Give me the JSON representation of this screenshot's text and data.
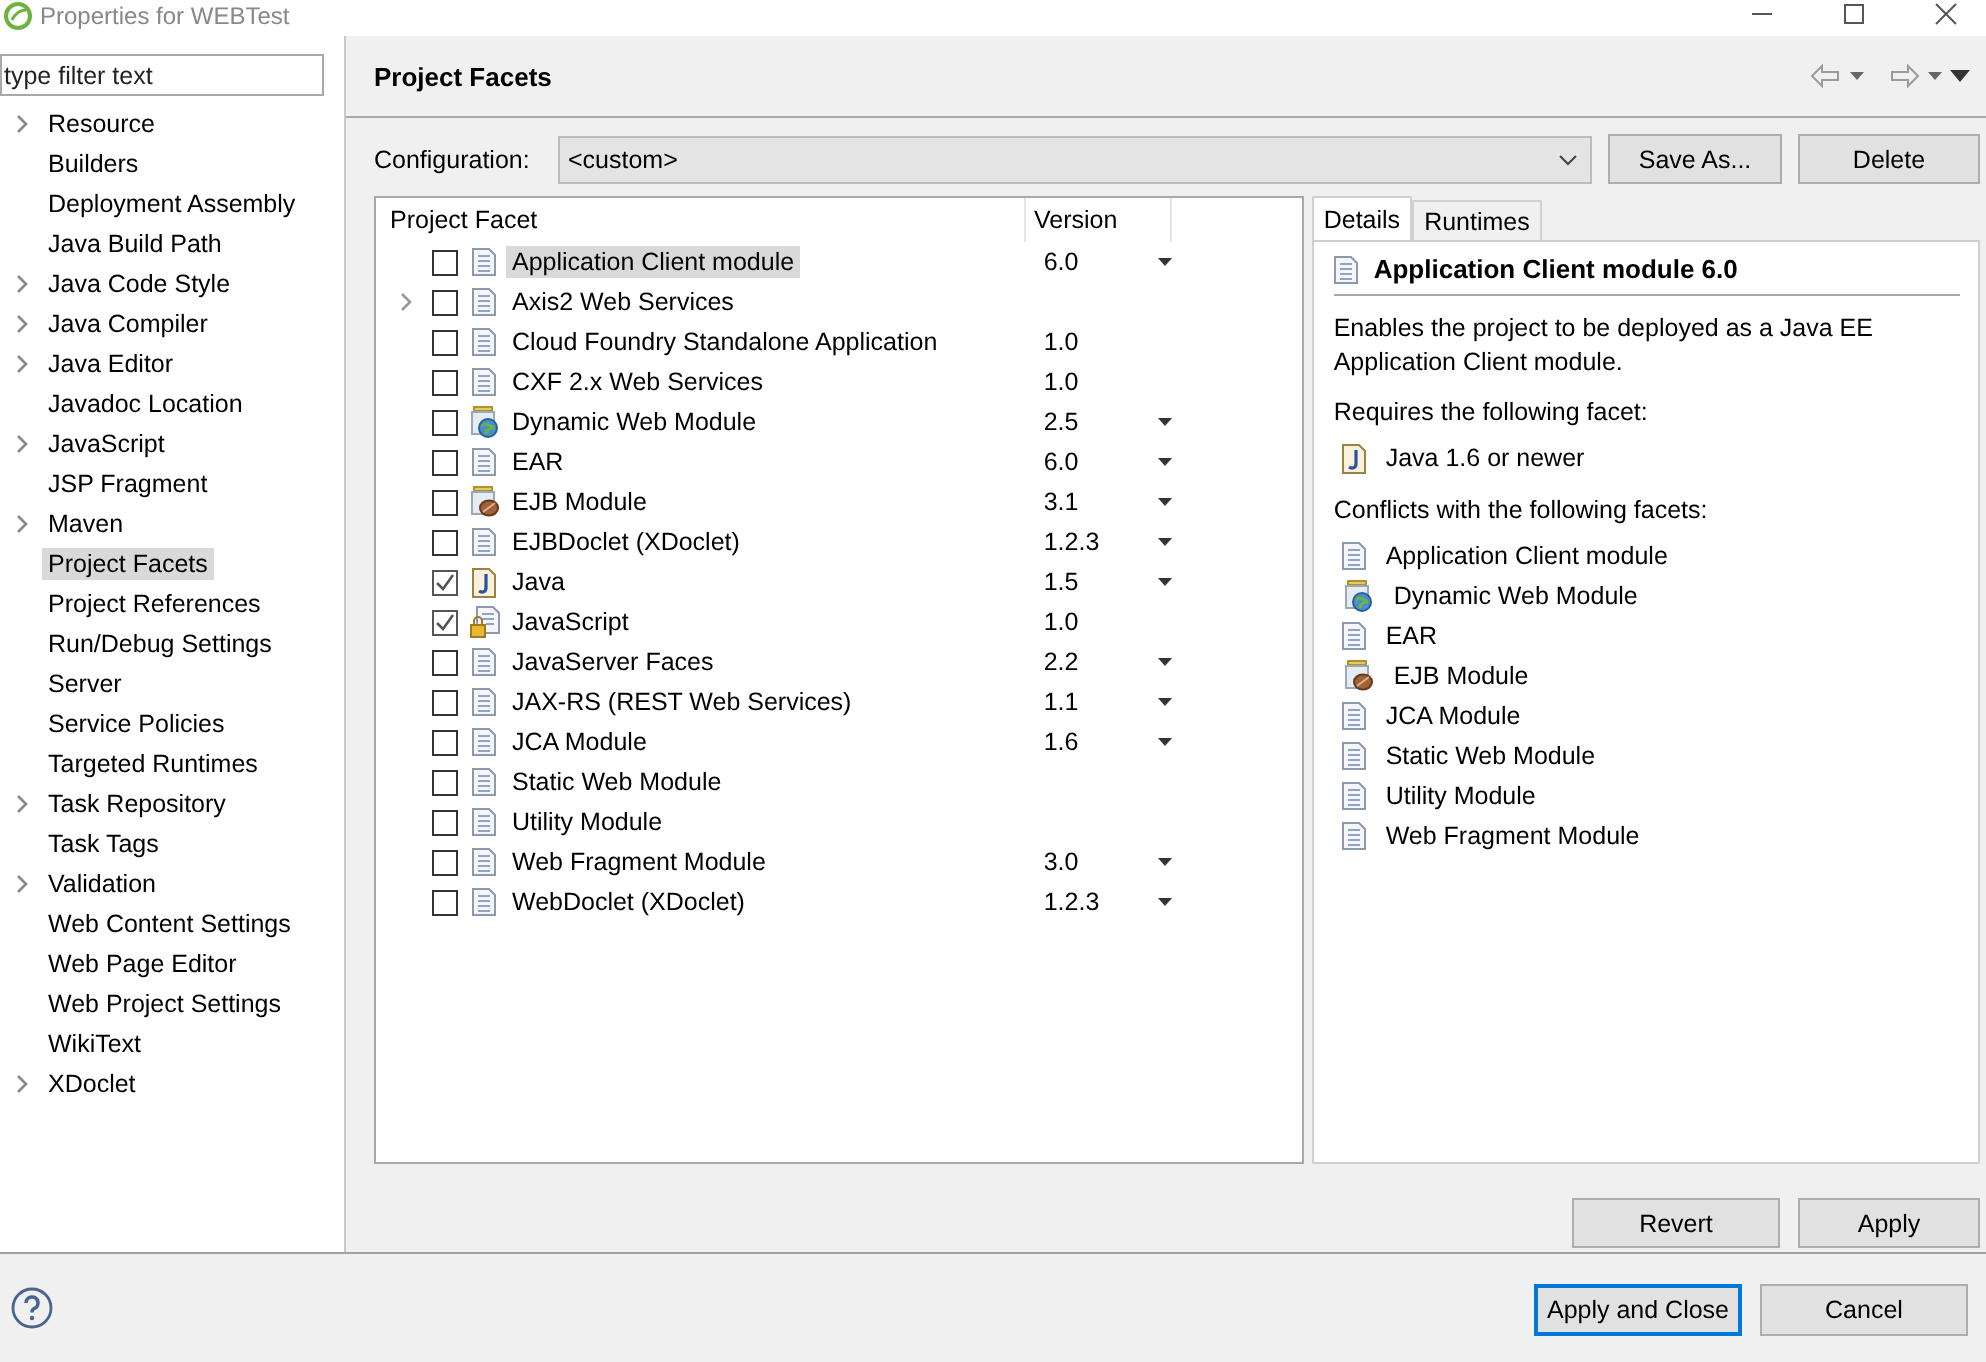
{
  "window": {
    "title": "Properties for WEBTest"
  },
  "sidebar": {
    "filter": {
      "placeholder": "type filter text"
    },
    "items": [
      {
        "label": "Resource",
        "expandable": true,
        "selected": false
      },
      {
        "label": "Builders",
        "expandable": false,
        "selected": false
      },
      {
        "label": "Deployment Assembly",
        "expandable": false,
        "selected": false
      },
      {
        "label": "Java Build Path",
        "expandable": false,
        "selected": false
      },
      {
        "label": "Java Code Style",
        "expandable": true,
        "selected": false
      },
      {
        "label": "Java Compiler",
        "expandable": true,
        "selected": false
      },
      {
        "label": "Java Editor",
        "expandable": true,
        "selected": false
      },
      {
        "label": "Javadoc Location",
        "expandable": false,
        "selected": false
      },
      {
        "label": "JavaScript",
        "expandable": true,
        "selected": false
      },
      {
        "label": "JSP Fragment",
        "expandable": false,
        "selected": false
      },
      {
        "label": "Maven",
        "expandable": true,
        "selected": false
      },
      {
        "label": "Project Facets",
        "expandable": false,
        "selected": true
      },
      {
        "label": "Project References",
        "expandable": false,
        "selected": false
      },
      {
        "label": "Run/Debug Settings",
        "expandable": false,
        "selected": false
      },
      {
        "label": "Server",
        "expandable": false,
        "selected": false
      },
      {
        "label": "Service Policies",
        "expandable": false,
        "selected": false
      },
      {
        "label": "Targeted Runtimes",
        "expandable": false,
        "selected": false
      },
      {
        "label": "Task Repository",
        "expandable": true,
        "selected": false
      },
      {
        "label": "Task Tags",
        "expandable": false,
        "selected": false
      },
      {
        "label": "Validation",
        "expandable": true,
        "selected": false
      },
      {
        "label": "Web Content Settings",
        "expandable": false,
        "selected": false
      },
      {
        "label": "Web Page Editor",
        "expandable": false,
        "selected": false
      },
      {
        "label": "Web Project Settings",
        "expandable": false,
        "selected": false
      },
      {
        "label": "WikiText",
        "expandable": false,
        "selected": false
      },
      {
        "label": "XDoclet",
        "expandable": true,
        "selected": false
      }
    ]
  },
  "page": {
    "title": "Project Facets",
    "configuration": {
      "label": "Configuration:",
      "value": "<custom>"
    },
    "buttons": [
      "Save As...",
      "Delete"
    ]
  },
  "facets": {
    "columns": [
      "Project Facet",
      "Version"
    ],
    "rows": [
      {
        "name": "Application Client module",
        "checked": false,
        "kind": "doc",
        "expandable": false,
        "version": "6.0",
        "has_menu": true,
        "selected": true
      },
      {
        "name": "Axis2 Web Services",
        "checked": false,
        "kind": "doc",
        "expandable": true,
        "has_menu": false,
        "selected": false
      },
      {
        "name": "Cloud Foundry Standalone Application",
        "checked": false,
        "kind": "doc",
        "expandable": false,
        "version": "1.0",
        "has_menu": false,
        "selected": false
      },
      {
        "name": "CXF 2.x Web Services",
        "checked": false,
        "kind": "doc",
        "expandable": false,
        "version": "1.0",
        "has_menu": false,
        "selected": false
      },
      {
        "name": "Dynamic Web Module",
        "checked": false,
        "kind": "web",
        "expandable": false,
        "version": "2.5",
        "has_menu": true,
        "selected": false
      },
      {
        "name": "EAR",
        "checked": false,
        "kind": "doc",
        "expandable": false,
        "version": "6.0",
        "has_menu": true,
        "selected": false
      },
      {
        "name": "EJB Module",
        "checked": false,
        "kind": "ejb",
        "expandable": false,
        "version": "3.1",
        "has_menu": true,
        "selected": false
      },
      {
        "name": "EJBDoclet (XDoclet)",
        "checked": false,
        "kind": "doc",
        "expandable": false,
        "version": "1.2.3",
        "has_menu": true,
        "selected": false
      },
      {
        "name": "Java",
        "checked": true,
        "kind": "java",
        "expandable": false,
        "version": "1.5",
        "has_menu": true,
        "selected": false
      },
      {
        "name": "JavaScript",
        "checked": true,
        "kind": "locked",
        "expandable": false,
        "version": "1.0",
        "has_menu": false,
        "selected": false
      },
      {
        "name": "JavaServer Faces",
        "checked": false,
        "kind": "doc",
        "expandable": false,
        "version": "2.2",
        "has_menu": true,
        "selected": false
      },
      {
        "name": "JAX-RS (REST Web Services)",
        "checked": false,
        "kind": "doc",
        "expandable": false,
        "version": "1.1",
        "has_menu": true,
        "selected": false
      },
      {
        "name": "JCA Module",
        "checked": false,
        "kind": "doc",
        "expandable": false,
        "version": "1.6",
        "has_menu": true,
        "selected": false
      },
      {
        "name": "Static Web Module",
        "checked": false,
        "kind": "doc",
        "expandable": false,
        "has_menu": false,
        "selected": false
      },
      {
        "name": "Utility Module",
        "checked": false,
        "kind": "doc",
        "expandable": false,
        "has_menu": false,
        "selected": false
      },
      {
        "name": "Web Fragment Module",
        "checked": false,
        "kind": "doc",
        "expandable": false,
        "version": "3.0",
        "has_menu": true,
        "selected": false
      },
      {
        "name": "WebDoclet (XDoclet)",
        "checked": false,
        "kind": "doc",
        "expandable": false,
        "version": "1.2.3",
        "has_menu": true,
        "selected": false
      }
    ]
  },
  "details": {
    "tabs": [
      {
        "label": "Details",
        "selected": true
      },
      {
        "label": "Runtimes",
        "selected": false
      }
    ],
    "title": "Application Client module 6.0",
    "kind": "doc",
    "description": "Enables the project to be deployed as a Java EE Application Client module.",
    "requires_heading": "Requires the following facet:",
    "requires": [
      {
        "label": "Java 1.6 or newer",
        "kind": "java"
      }
    ],
    "conflicts_heading": "Conflicts with the following facets:",
    "conflicts": [
      {
        "label": "Application Client module",
        "kind": "doc"
      },
      {
        "label": "Dynamic Web Module",
        "kind": "web"
      },
      {
        "label": "EAR",
        "kind": "doc"
      },
      {
        "label": "EJB Module",
        "kind": "ejb"
      },
      {
        "label": "JCA Module",
        "kind": "doc"
      },
      {
        "label": "Static Web Module",
        "kind": "doc"
      },
      {
        "label": "Utility Module",
        "kind": "doc"
      },
      {
        "label": "Web Fragment Module",
        "kind": "doc"
      }
    ]
  },
  "actions": [
    "Revert",
    "Apply"
  ],
  "footer": {
    "buttons": [
      {
        "label": "Apply and Close",
        "default": true
      },
      {
        "label": "Cancel",
        "default": false
      }
    ]
  }
}
